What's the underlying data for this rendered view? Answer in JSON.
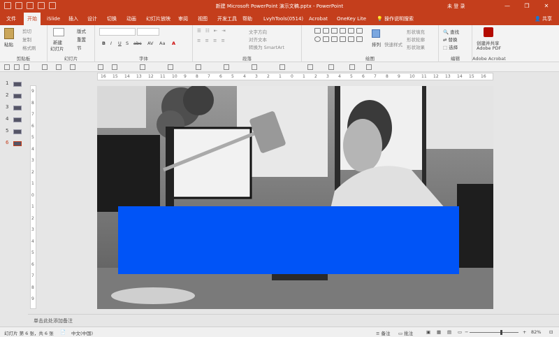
{
  "window": {
    "title": "新建 Microsoft PowerPoint 演示文稿.pptx - PowerPoint",
    "user": "未 登 录",
    "minimize": "—",
    "restore": "❐",
    "close": "✕"
  },
  "tabs": [
    "文件",
    "开始",
    "iSlide",
    "插入",
    "设计",
    "切换",
    "动画",
    "幻灯片放映",
    "审阅",
    "视图",
    "开发工具",
    "帮助",
    "LvyhTools(0514)",
    "Acrobat",
    "OneKey Lite",
    "操作说明搜索"
  ],
  "active_tab": "开始",
  "share_label": "共享",
  "ribbon": {
    "clipboard": {
      "paste": "粘贴",
      "cut": "剪切",
      "copy": "复制",
      "format_painter": "格式刷",
      "label": "剪贴板"
    },
    "slides": {
      "new_slide": "新建",
      "new_slide_2": "幻灯片",
      "layout": "版式",
      "reset": "重置",
      "section": "节",
      "label": "幻灯片"
    },
    "font": {
      "label": "字体",
      "bold": "B",
      "italic": "I",
      "underline": "U",
      "strike": "S",
      "abc": "abc",
      "av": "AV",
      "aa": "Aa",
      "a_color": "A"
    },
    "paragraph": {
      "label": "段落",
      "text_direction": "文字方向",
      "align_text": "对齐文本",
      "smartart": "转换为 SmartArt"
    },
    "drawing": {
      "label": "绘图",
      "arrange": "排列",
      "quick_styles": "快速样式",
      "shape_fill": "形状填充",
      "shape_outline": "形状轮廓",
      "shape_effects": "形状效果"
    },
    "editing": {
      "label": "编辑",
      "find": "查找",
      "replace": "替换",
      "select": "选择"
    },
    "acrobat": {
      "label": "Adobe Acrobat",
      "create": "创建并共享",
      "pdf": "Adobe PDF"
    }
  },
  "slides_panel": {
    "numbers": [
      "1",
      "2",
      "3",
      "4",
      "5",
      "6"
    ],
    "selected": "6"
  },
  "ruler_h": [
    "16",
    "15",
    "14",
    "13",
    "12",
    "11",
    "10",
    "9",
    "8",
    "7",
    "6",
    "5",
    "4",
    "3",
    "2",
    "1",
    "0",
    "1",
    "2",
    "3",
    "4",
    "5",
    "6",
    "7",
    "8",
    "9",
    "10",
    "11",
    "12",
    "13",
    "14",
    "15",
    "16"
  ],
  "ruler_v": [
    "9",
    "8",
    "7",
    "6",
    "5",
    "4",
    "3",
    "2",
    "1",
    "0",
    "1",
    "2",
    "3",
    "4",
    "5",
    "6",
    "7",
    "8",
    "9"
  ],
  "slide": {
    "shape_color": "#0054f7"
  },
  "notes_placeholder": "单击此处添加备注",
  "status": {
    "slide_info": "幻灯片 第 6 张，共 6 张",
    "language": "中文(中国)",
    "notes": "备注",
    "comments": "批注",
    "zoom": "82%"
  },
  "colors": {
    "accent": "#c43e1c"
  }
}
